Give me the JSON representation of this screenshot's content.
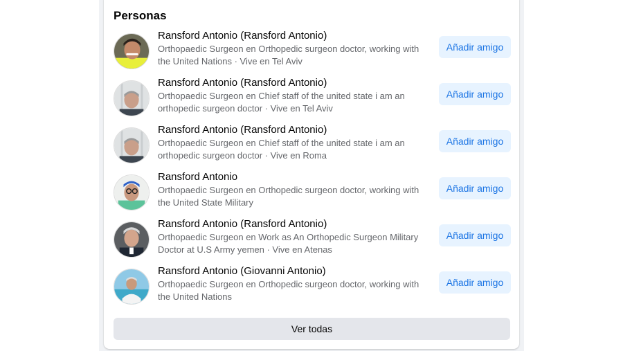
{
  "section": {
    "title": "Personas"
  },
  "people": [
    {
      "name": "Ransford Antonio (Ransford Antonio)",
      "desc_line1": "Orthopaedic Surgeon en Orthopedic surgeon doctor, working with",
      "desc_line2": "the United Nations · Vive en Tel Aviv",
      "button": "Añadir amigo"
    },
    {
      "name": "Ransford Antonio (Ransford Antonio)",
      "desc_line1": "Orthopaedic Surgeon en Chief staff of the united state i am an",
      "desc_line2": "orthopedic surgeon doctor · Vive en Tel Aviv",
      "button": "Añadir amigo"
    },
    {
      "name": "Ransford Antonio (Ransford Antonio)",
      "desc_line1": "Orthopaedic Surgeon en Chief staff of the united state i am an",
      "desc_line2": "orthopedic surgeon doctor · Vive en Roma",
      "button": "Añadir amigo"
    },
    {
      "name": "Ransford Antonio",
      "desc_line1": "Orthopaedic Surgeon en Orthopedic surgeon doctor, working with",
      "desc_line2": "the United State Military",
      "button": "Añadir amigo"
    },
    {
      "name": "Ransford Antonio (Ransford Antonio)",
      "desc_line1": "Orthopaedic Surgeon en Work as An Orthopedic Surgeon Military",
      "desc_line2": "Doctor at U.S Army yemen · Vive en Atenas",
      "button": "Añadir amigo"
    },
    {
      "name": "Ransford Antonio (Giovanni Antonio)",
      "desc_line1": "Orthopaedic Surgeon en Orthopedic surgeon doctor, working with",
      "desc_line2": "the United Nations",
      "button": "Añadir amigo"
    }
  ],
  "footer": {
    "see_all": "Ver todas"
  }
}
